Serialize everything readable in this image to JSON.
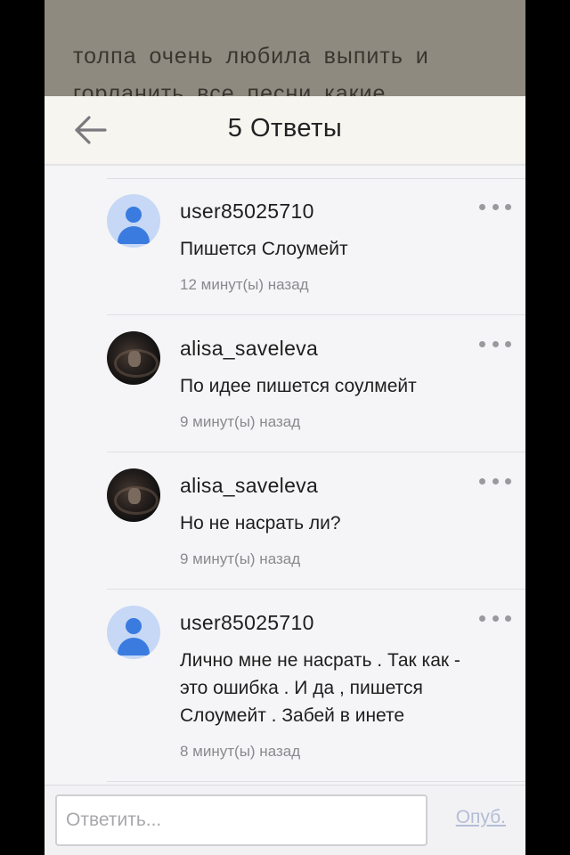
{
  "background_post": {
    "line1": "толпа очень любила выпить и",
    "line2": "горланить все песни какие"
  },
  "header": {
    "back_icon": "arrow-left-icon",
    "title": "5 Ответы"
  },
  "comments": [
    {
      "user": "user85025710",
      "avatar": "default-user-icon",
      "text": "Пишется Слоумейт",
      "time": "12 минут(ы) назад"
    },
    {
      "user": "alisa_saveleva",
      "avatar": "photo",
      "text": "По идее пишется соулмейт",
      "time": "9 минут(ы) назад"
    },
    {
      "user": "alisa_saveleva",
      "avatar": "photo",
      "text": "Но не насрать ли?",
      "time": "9 минут(ы) назад"
    },
    {
      "user": "user85025710",
      "avatar": "default-user-icon",
      "text": "Лично мне не насрать . Так как - это ошибка . И да , пишется Слоумейт . Забей в инете",
      "time": "8 минут(ы) назад"
    }
  ],
  "reply": {
    "placeholder": "Ответить...",
    "publish_label": "Опуб."
  },
  "colors": {
    "accent_avatar": "#3a7be0",
    "publish_disabled": "#b4bdd6"
  }
}
